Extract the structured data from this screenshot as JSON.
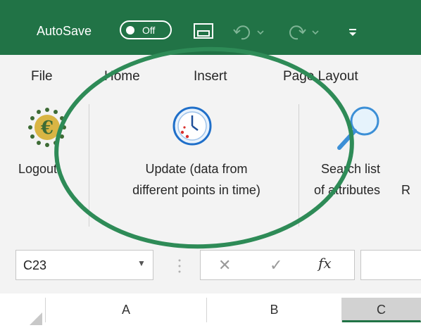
{
  "titlebar": {
    "autosave_label": "AutoSave",
    "autosave_state": "Off",
    "icons": [
      "save-icon",
      "undo-icon",
      "redo-icon",
      "customize-qat-icon"
    ]
  },
  "menu": {
    "file": "File",
    "home": "Home",
    "insert": "Insert",
    "page_layout": "Page Layout"
  },
  "ribbon": {
    "logout_label": "Logout",
    "update_line1": "Update (data from",
    "update_line2": "different points in time)",
    "search_line1": "Search list",
    "search_line2": "of attributes",
    "truncated_label": "R"
  },
  "formula_bar": {
    "name_box": "C23",
    "cancel_symbol": "✕",
    "enter_symbol": "✓",
    "fx_symbol": "fx"
  },
  "columns": [
    "A",
    "B",
    "C"
  ],
  "colors": {
    "title_bar": "#217346",
    "annotation_circle": "#2e8b57"
  }
}
